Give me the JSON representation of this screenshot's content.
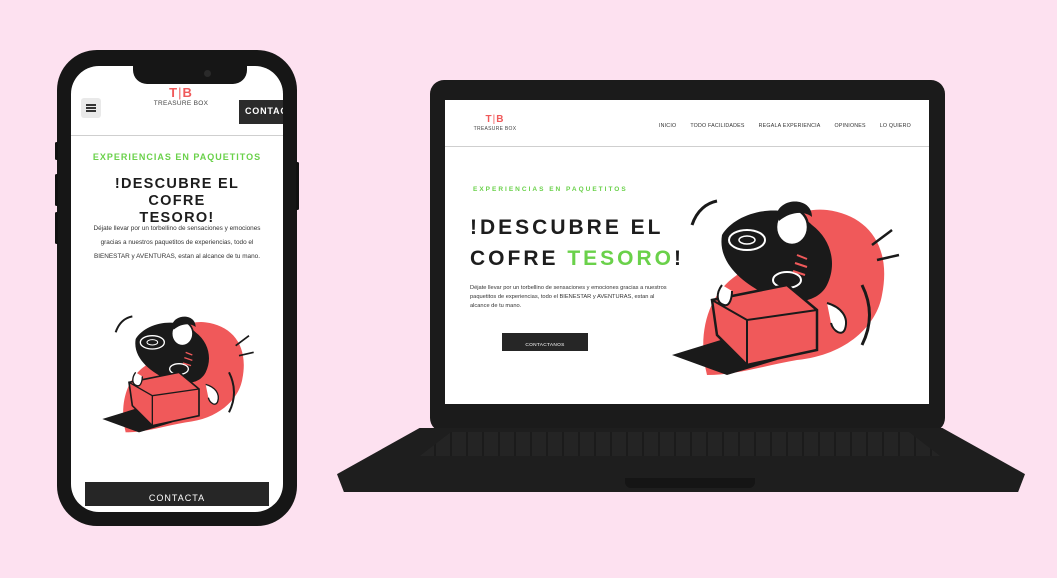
{
  "brand": {
    "mark_left": "T",
    "mark_sep": "|",
    "mark_right": "B",
    "name": "TREASURE BOX"
  },
  "colors": {
    "background": "#fde1f0",
    "accent_green": "#6ad14a",
    "accent_coral": "#f0595a",
    "dark": "#262626"
  },
  "mobile": {
    "menu_icon": "hamburger-icon",
    "header_contact": "CONTACTA",
    "kicker": "EXPERIENCIAS EN PAQUETITOS",
    "title_line1": "!DESCUBRE EL COFRE",
    "title_line2": "TESORO!",
    "text": "Déjate llevar por un torbellino de sensaciones y emociones gracias a nuestros paquetitos de experiencias, todo el BIENESTAR y AVENTURAS, estan al alcance de tu mano.",
    "cta": "CONTACTA"
  },
  "desktop": {
    "nav": [
      "INICIO",
      "TODO FACILIDADES",
      "REGALA EXPERIENCIA",
      "OPINIONES",
      "LO QUIERO"
    ],
    "kicker": "EXPERIENCIAS EN PAQUETITOS",
    "title_line1": "!DESCUBRE EL",
    "title_line2_a": "COFRE ",
    "title_line2_b": "TESORO",
    "title_line2_c": "!",
    "text": "Déjate llevar por un torbellino de sensaciones y emociones gracias a nuestros paquetitos de experiencias, todo el BIENESTAR y AVENTURAS, estan al alcance de tu mano.",
    "cta": "CONTACTANOS"
  }
}
